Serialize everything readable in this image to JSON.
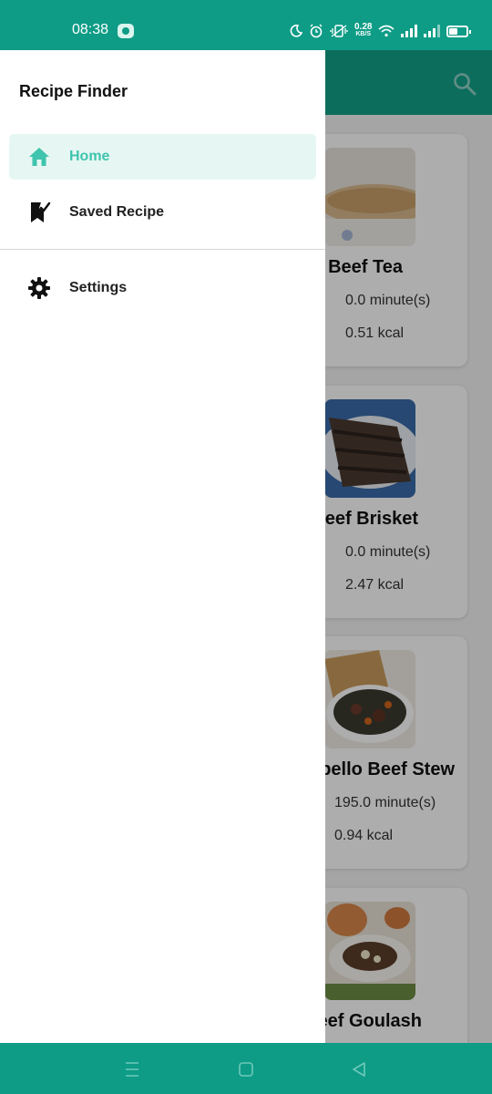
{
  "status_bar": {
    "time": "08:38",
    "net_speed_value": "0.28",
    "net_speed_unit": "KB/S",
    "icons": [
      "chat-bubble-icon",
      "moon-icon",
      "alarm-icon",
      "vibrate-icon",
      "wifi-icon",
      "signal-icon",
      "signal-icon",
      "battery-icon"
    ]
  },
  "drawer": {
    "title": "Recipe Finder",
    "items": [
      {
        "label": "Home",
        "icon": "home-icon",
        "active": true
      },
      {
        "label": "Saved Recipe",
        "icon": "bookmark-check-icon",
        "active": false
      },
      {
        "label": "Settings",
        "icon": "gear-icon",
        "active": false
      }
    ]
  },
  "app_bar": {
    "search_icon": "search-icon"
  },
  "recipes": [
    {
      "title": "Beef Tea",
      "time": "0.0 minute(s)",
      "kcal": "0.51 kcal"
    },
    {
      "title": "eef Brisket",
      "time": "0.0 minute(s)",
      "kcal": "2.47 kcal"
    },
    {
      "title": "bello Beef Stew",
      "time": "195.0 minute(s)",
      "kcal": "0.94 kcal"
    },
    {
      "title": "eef Goulash",
      "time": "",
      "kcal": ""
    }
  ],
  "nav_bar": {
    "icons": [
      "menu-lines-icon",
      "home-square-icon",
      "back-triangle-icon"
    ]
  },
  "colors": {
    "brand": "#0e9c86",
    "accent": "#3fc4ad",
    "active_bg": "#e6f7f3"
  }
}
